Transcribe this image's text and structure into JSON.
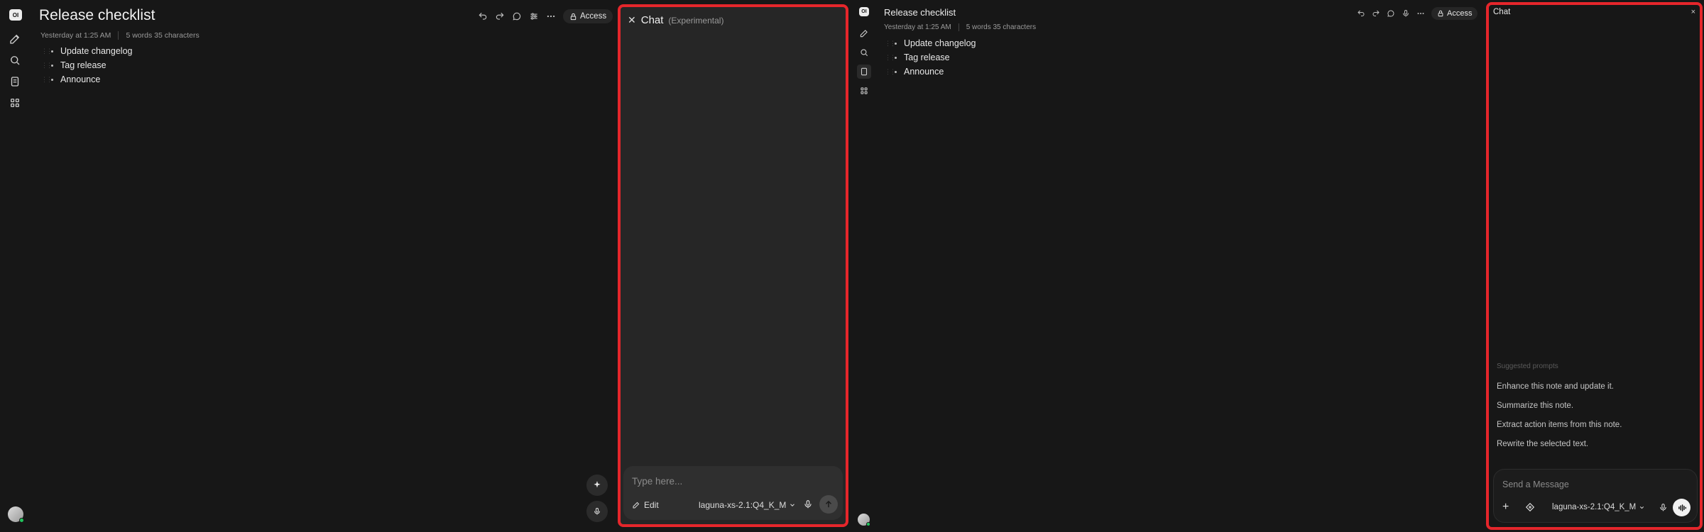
{
  "left": {
    "logo": "OI",
    "note": {
      "title": "Release checklist",
      "updated": "Yesterday at 1:25 AM",
      "stats": "5 words 35 characters",
      "items": [
        "Update changelog",
        "Tag release",
        "Announce"
      ]
    },
    "toolbar": {
      "access_label": "Access"
    },
    "chat": {
      "title": "Chat",
      "subtitle": "(Experimental)",
      "placeholder": "Type here...",
      "edit_label": "Edit",
      "model": "laguna-xs-2.1:Q4_K_M"
    }
  },
  "right": {
    "logo": "OI",
    "note": {
      "title": "Release checklist",
      "updated": "Yesterday at 1:25 AM",
      "stats": "5 words 35 characters",
      "items": [
        "Update changelog",
        "Tag release",
        "Announce"
      ]
    },
    "toolbar": {
      "access_label": "Access"
    },
    "chat": {
      "title": "Chat",
      "close": "×",
      "suggested_label": "Suggested prompts",
      "suggestions": [
        "Enhance this note and update it.",
        "Summarize this note.",
        "Extract action items from this note.",
        "Rewrite the selected text."
      ],
      "placeholder": "Send a Message",
      "model": "laguna-xs-2.1:Q4_K_M"
    }
  },
  "colors": {
    "highlight_border": "#e5262b",
    "background": "#171717",
    "panel": "#262626"
  }
}
